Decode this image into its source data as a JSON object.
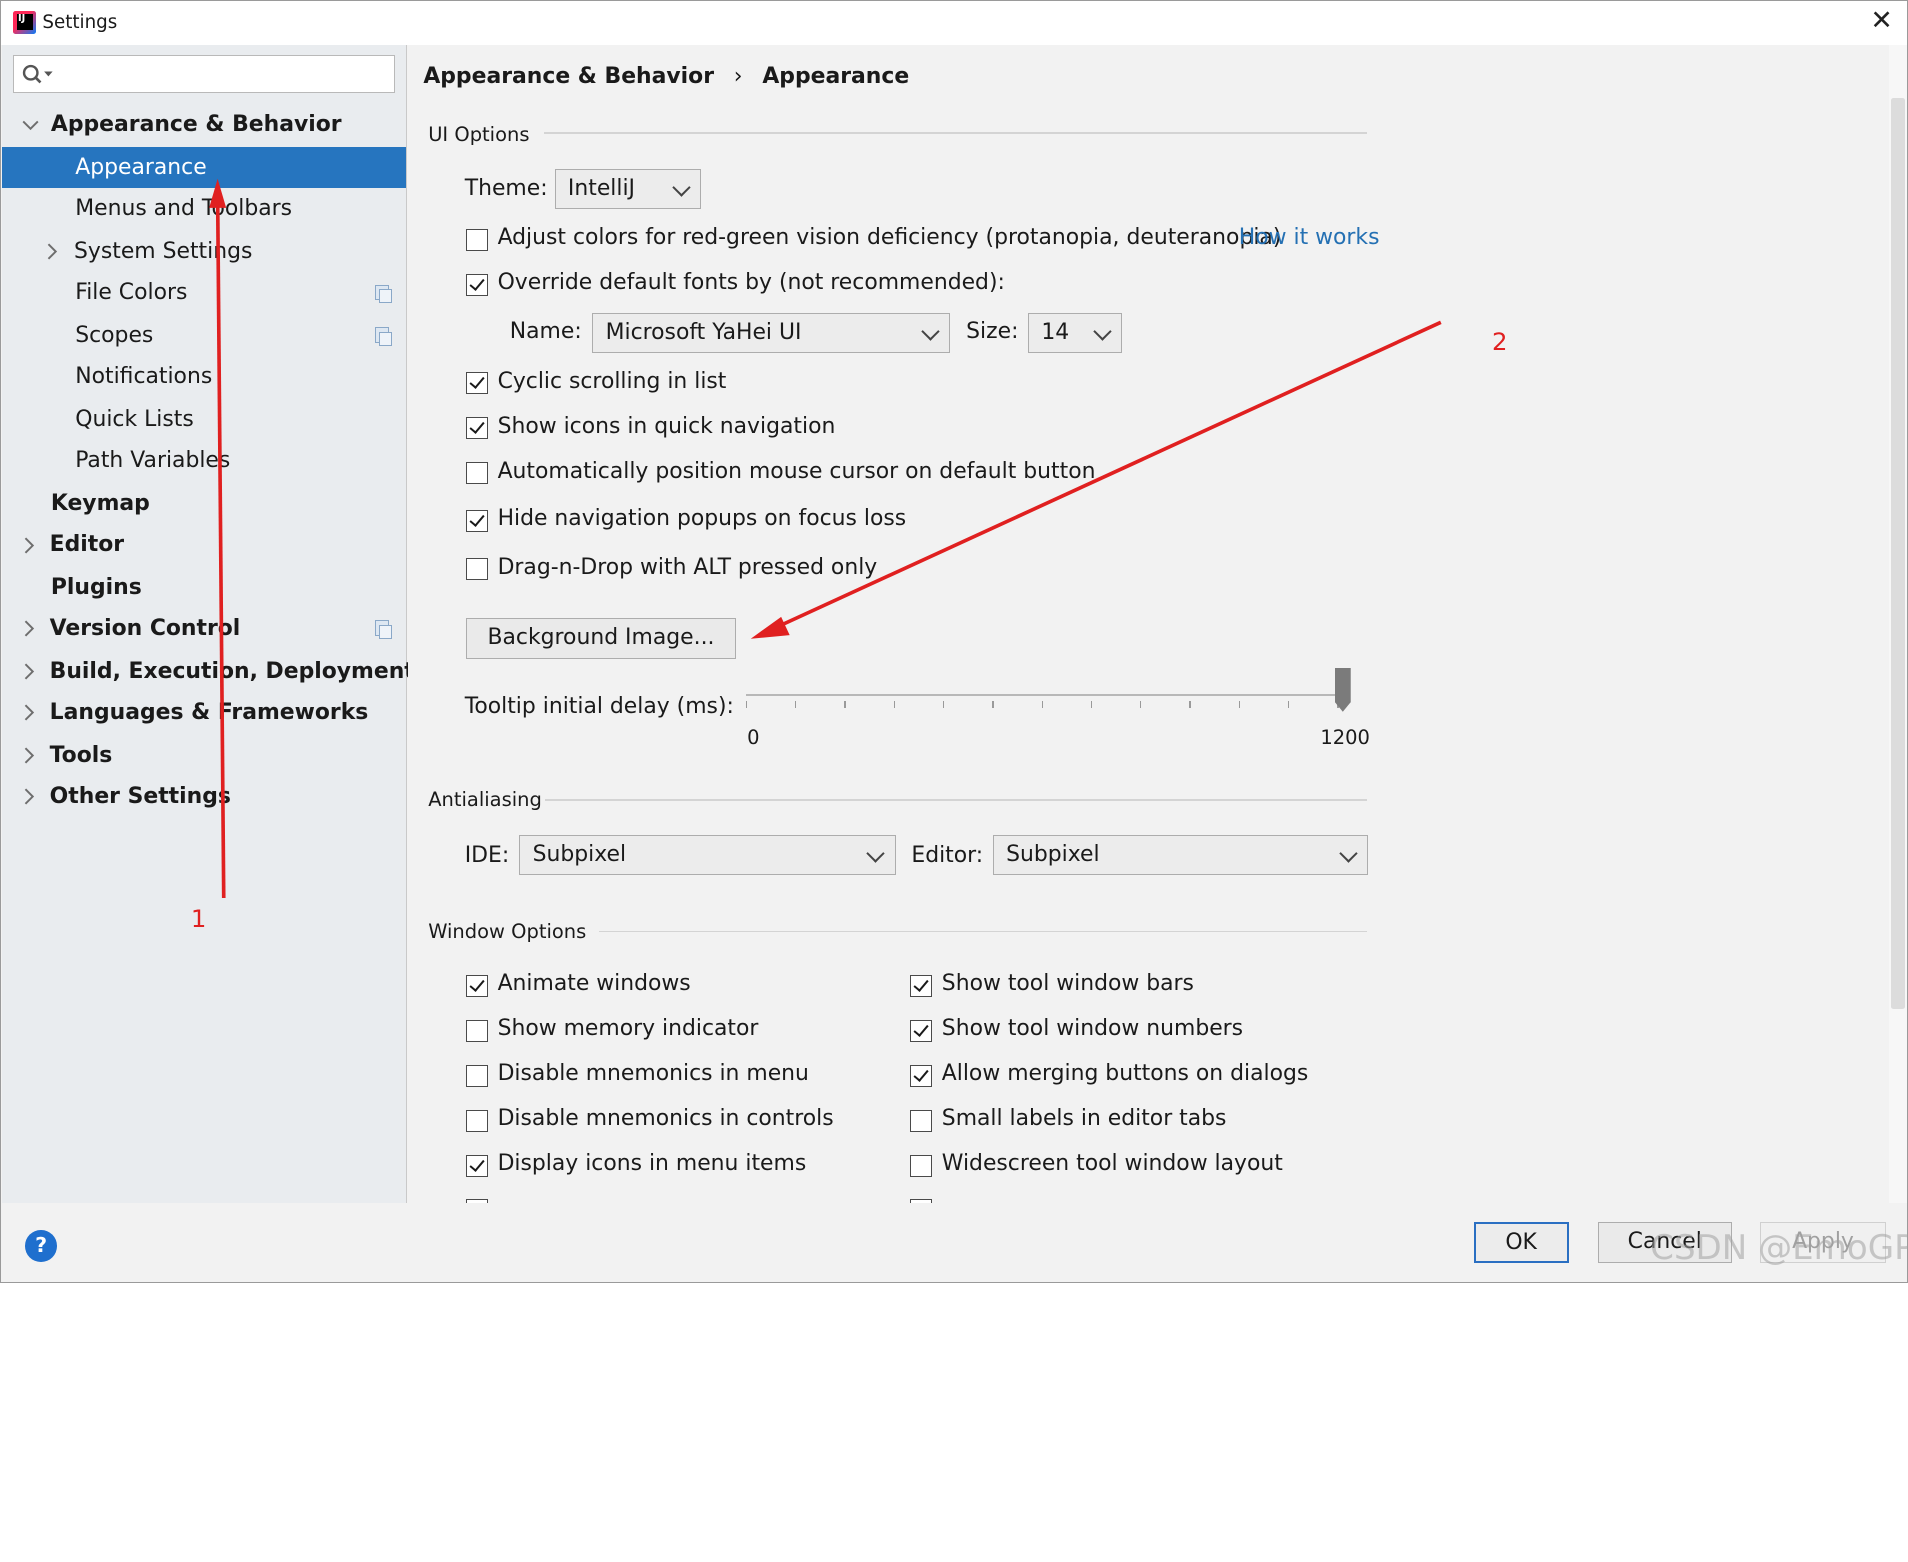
{
  "window": {
    "title": "Settings",
    "close_glyph": "✕"
  },
  "sidebar": {
    "search_placeholder": "",
    "items": [
      {
        "label": "Appearance & Behavior"
      },
      {
        "label": "Appearance"
      },
      {
        "label": "Menus and Toolbars"
      },
      {
        "label": "System Settings"
      },
      {
        "label": "File Colors"
      },
      {
        "label": "Scopes"
      },
      {
        "label": "Notifications"
      },
      {
        "label": "Quick Lists"
      },
      {
        "label": "Path Variables"
      },
      {
        "label": "Keymap"
      },
      {
        "label": "Editor"
      },
      {
        "label": "Plugins"
      },
      {
        "label": "Version Control"
      },
      {
        "label": "Build, Execution, Deployment"
      },
      {
        "label": "Languages & Frameworks"
      },
      {
        "label": "Tools"
      },
      {
        "label": "Other Settings"
      }
    ]
  },
  "breadcrumb": {
    "parent": "Appearance & Behavior",
    "separator": "›",
    "current": "Appearance"
  },
  "ui_options": {
    "title": "UI Options",
    "theme_label": "Theme:",
    "theme_value": "IntelliJ",
    "adjust_colors": {
      "label": "Adjust colors for red-green vision deficiency (protanopia, deuteranopia)",
      "checked": false
    },
    "how_it_works": "How it works",
    "override_fonts": {
      "label": "Override default fonts by (not recommended):",
      "checked": true
    },
    "name_label": "Name:",
    "font_name": "Microsoft YaHei UI",
    "size_label": "Size:",
    "font_size": "14",
    "cyclic_scrolling": {
      "label": "Cyclic scrolling in list",
      "checked": true
    },
    "show_icons_nav": {
      "label": "Show icons in quick navigation",
      "checked": true
    },
    "auto_position_mouse": {
      "label": "Automatically position mouse cursor on default button",
      "checked": false
    },
    "hide_nav_popups": {
      "label": "Hide navigation popups on focus loss",
      "checked": true
    },
    "drag_alt": {
      "label": "Drag-n-Drop with ALT pressed only",
      "checked": false
    },
    "background_image_button": "Background Image...",
    "tooltip_label": "Tooltip initial delay (ms):",
    "tooltip_min": "0",
    "tooltip_max": "1200",
    "tooltip_value": 1200
  },
  "antialiasing": {
    "title": "Antialiasing",
    "ide_label": "IDE:",
    "ide_value": "Subpixel",
    "editor_label": "Editor:",
    "editor_value": "Subpixel"
  },
  "window_options": {
    "title": "Window Options",
    "left": [
      {
        "label": "Animate windows",
        "checked": true
      },
      {
        "label": "Show memory indicator",
        "checked": false
      },
      {
        "label": "Disable mnemonics in menu",
        "checked": false
      },
      {
        "label": "Disable mnemonics in controls",
        "checked": false
      },
      {
        "label": "Display icons in menu items",
        "checked": true
      }
    ],
    "right": [
      {
        "label": "Show tool window bars",
        "checked": true
      },
      {
        "label": "Show tool window numbers",
        "checked": true
      },
      {
        "label": "Allow merging buttons on dialogs",
        "checked": true
      },
      {
        "label": "Small labels in editor tabs",
        "checked": false
      },
      {
        "label": "Widescreen tool window layout",
        "checked": false
      }
    ]
  },
  "footer": {
    "help": "?",
    "ok": "OK",
    "cancel": "Cancel",
    "apply": "Apply"
  },
  "annotations": {
    "arrow1_label": "1",
    "arrow2_label": "2",
    "color": "#e02020"
  },
  "watermark": "CSDN @EmoGP",
  "colors": {
    "selection": "#2675bf",
    "link": "#2470b3",
    "help": "#1f6fce"
  }
}
